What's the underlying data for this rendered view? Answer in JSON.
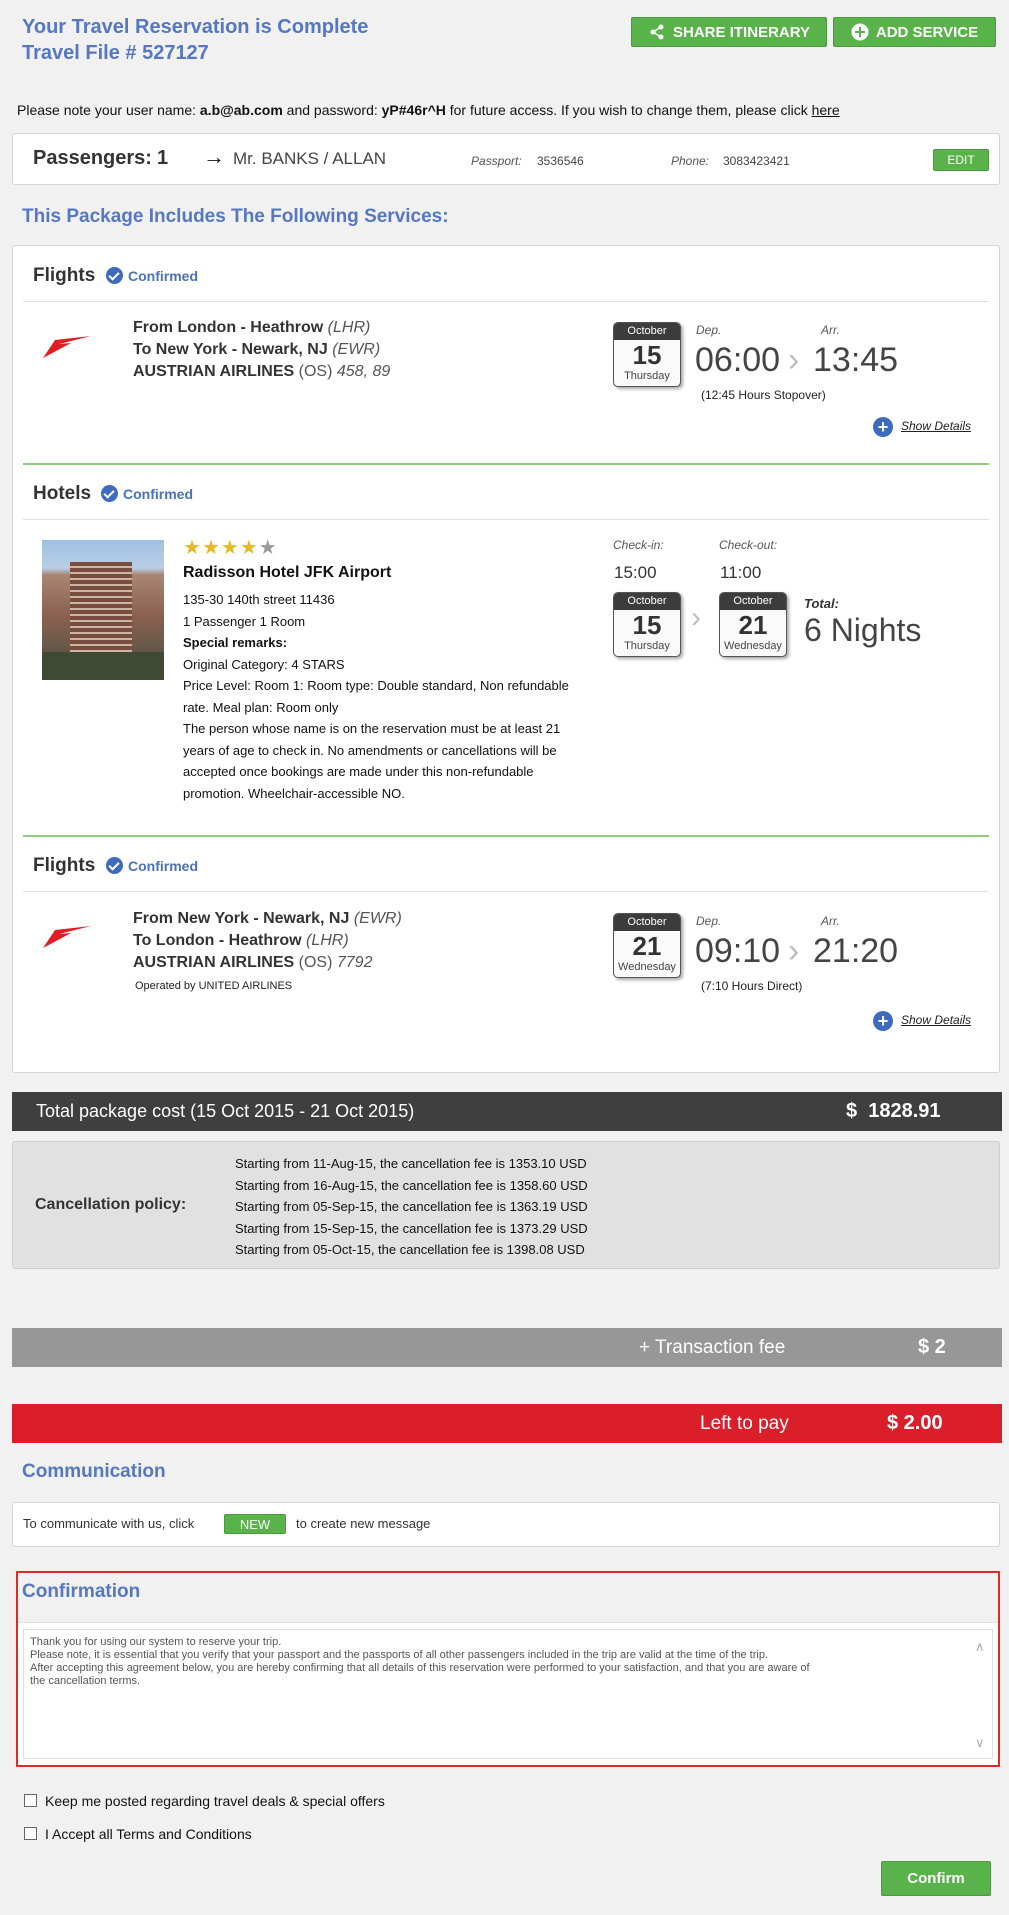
{
  "header": {
    "title": "Your Travel Reservation is Complete",
    "file_no": "Travel File # 527127",
    "share_label": "SHARE ITINERARY",
    "add_label": "ADD SERVICE"
  },
  "note": {
    "prefix": "Please note your user name: ",
    "username": "a.b@ab.com",
    "middle": " and password: ",
    "password": "yP#46r^H",
    "suffix": " for future access. If you wish to change them, please click ",
    "link": "here"
  },
  "passengers": {
    "label": "Passengers:",
    "count": "1",
    "name": "Mr. BANKS / ALLAN",
    "passport_label": "Passport:",
    "passport": "3536546",
    "phone_label": "Phone:",
    "phone": "3083423421",
    "edit_label": "EDIT"
  },
  "services_heading": "This Package Includes The Following Services:",
  "confirmed_label": "Confirmed",
  "show_details_label": "Show Details",
  "dep_label": "Dep.",
  "arr_label": "Arr.",
  "flight1": {
    "title": "Flights",
    "from": "From London - Heathrow",
    "from_code": "(LHR)",
    "to": "To New York - Newark, NJ",
    "to_code": "(EWR)",
    "airline": "AUSTRIAN AIRLINES",
    "airline_code": "(OS)",
    "flight_nos": "458, 89",
    "month": "October",
    "day": "15",
    "weekday": "Thursday",
    "dep": "06:00",
    "arr": "13:45",
    "stopover": "(12:45 Hours Stopover)"
  },
  "hotel": {
    "title": "Hotels",
    "rating": 4,
    "max_rating": 5,
    "name": "Radisson Hotel JFK Airport",
    "address": "135-30 140th street 11436",
    "occupancy": "1 Passenger 1 Room",
    "remarks_label": "Special remarks:",
    "remarks": [
      "Original Category: 4 STARS",
      "Price Level: Room 1: Room type: Double standard, Non refundable",
      "rate. Meal plan: Room only",
      "The person whose name is on the reservation must be at least 21",
      "years of age to check in. No amendments or cancellations will be",
      "accepted once bookings are made under this non-refundable",
      "promotion. Wheelchair-accessible NO."
    ],
    "checkin_label": "Check-in:",
    "checkin_time": "15:00",
    "checkout_label": "Check-out:",
    "checkout_time": "11:00",
    "in_month": "October",
    "in_day": "15",
    "in_weekday": "Thursday",
    "out_month": "October",
    "out_day": "21",
    "out_weekday": "Wednesday",
    "total_label": "Total:",
    "nights": "6 Nights"
  },
  "flight2": {
    "title": "Flights",
    "from": "From New York - Newark, NJ",
    "from_code": "(EWR)",
    "to": "To London - Heathrow",
    "to_code": "(LHR)",
    "airline": "AUSTRIAN AIRLINES",
    "airline_code": "(OS)",
    "flight_nos": "7792",
    "operated": "Operated by UNITED AIRLINES",
    "month": "October",
    "day": "21",
    "weekday": "Wednesday",
    "dep": "09:10",
    "arr": "21:20",
    "stopover": "(7:10 Hours Direct)"
  },
  "total": {
    "label": "Total package cost (15 Oct 2015 - 21 Oct 2015)",
    "currency": "$",
    "amount": "1828.91"
  },
  "cancellation": {
    "label": "Cancellation policy:",
    "lines": [
      "Starting from 11-Aug-15, the cancellation fee is 1353.10 USD",
      "Starting from 16-Aug-15, the cancellation fee is 1358.60 USD",
      "Starting from 05-Sep-15, the cancellation fee is 1363.19 USD",
      "Starting from 15-Sep-15, the cancellation fee is 1373.29 USD",
      "Starting from 05-Oct-15, the cancellation fee is 1398.08 USD"
    ]
  },
  "transaction": {
    "label": "+ Transaction fee",
    "amount": "$ 2"
  },
  "left_to_pay": {
    "label": "Left to pay",
    "amount": "$ 2.00"
  },
  "communication": {
    "heading": "Communication",
    "prefix": "To communicate with us, click",
    "new_label": "NEW",
    "suffix": "to create new message"
  },
  "confirmation": {
    "heading": "Confirmation",
    "text_lines": [
      "Thank you for using our system to reserve your trip.",
      "Please note, it is essential that you verify that your passport and the passports of all other passengers included in the trip are valid at the time of the trip.",
      "After accepting this agreement below, you are hereby confirming that all details of this reservation were performed to your satisfaction, and that you are aware of",
      "the cancellation terms."
    ],
    "keep_posted_label": "Keep me posted regarding travel deals & special offers",
    "accept_terms_label": "I Accept all Terms and Conditions",
    "confirm_label": "Confirm"
  },
  "colors": {
    "accent_blue": "#5577c4",
    "green": "#5ab34a",
    "red": "#da1f2a",
    "dark_bar": "#3f3f3f",
    "star_gold": "#e7b928"
  }
}
